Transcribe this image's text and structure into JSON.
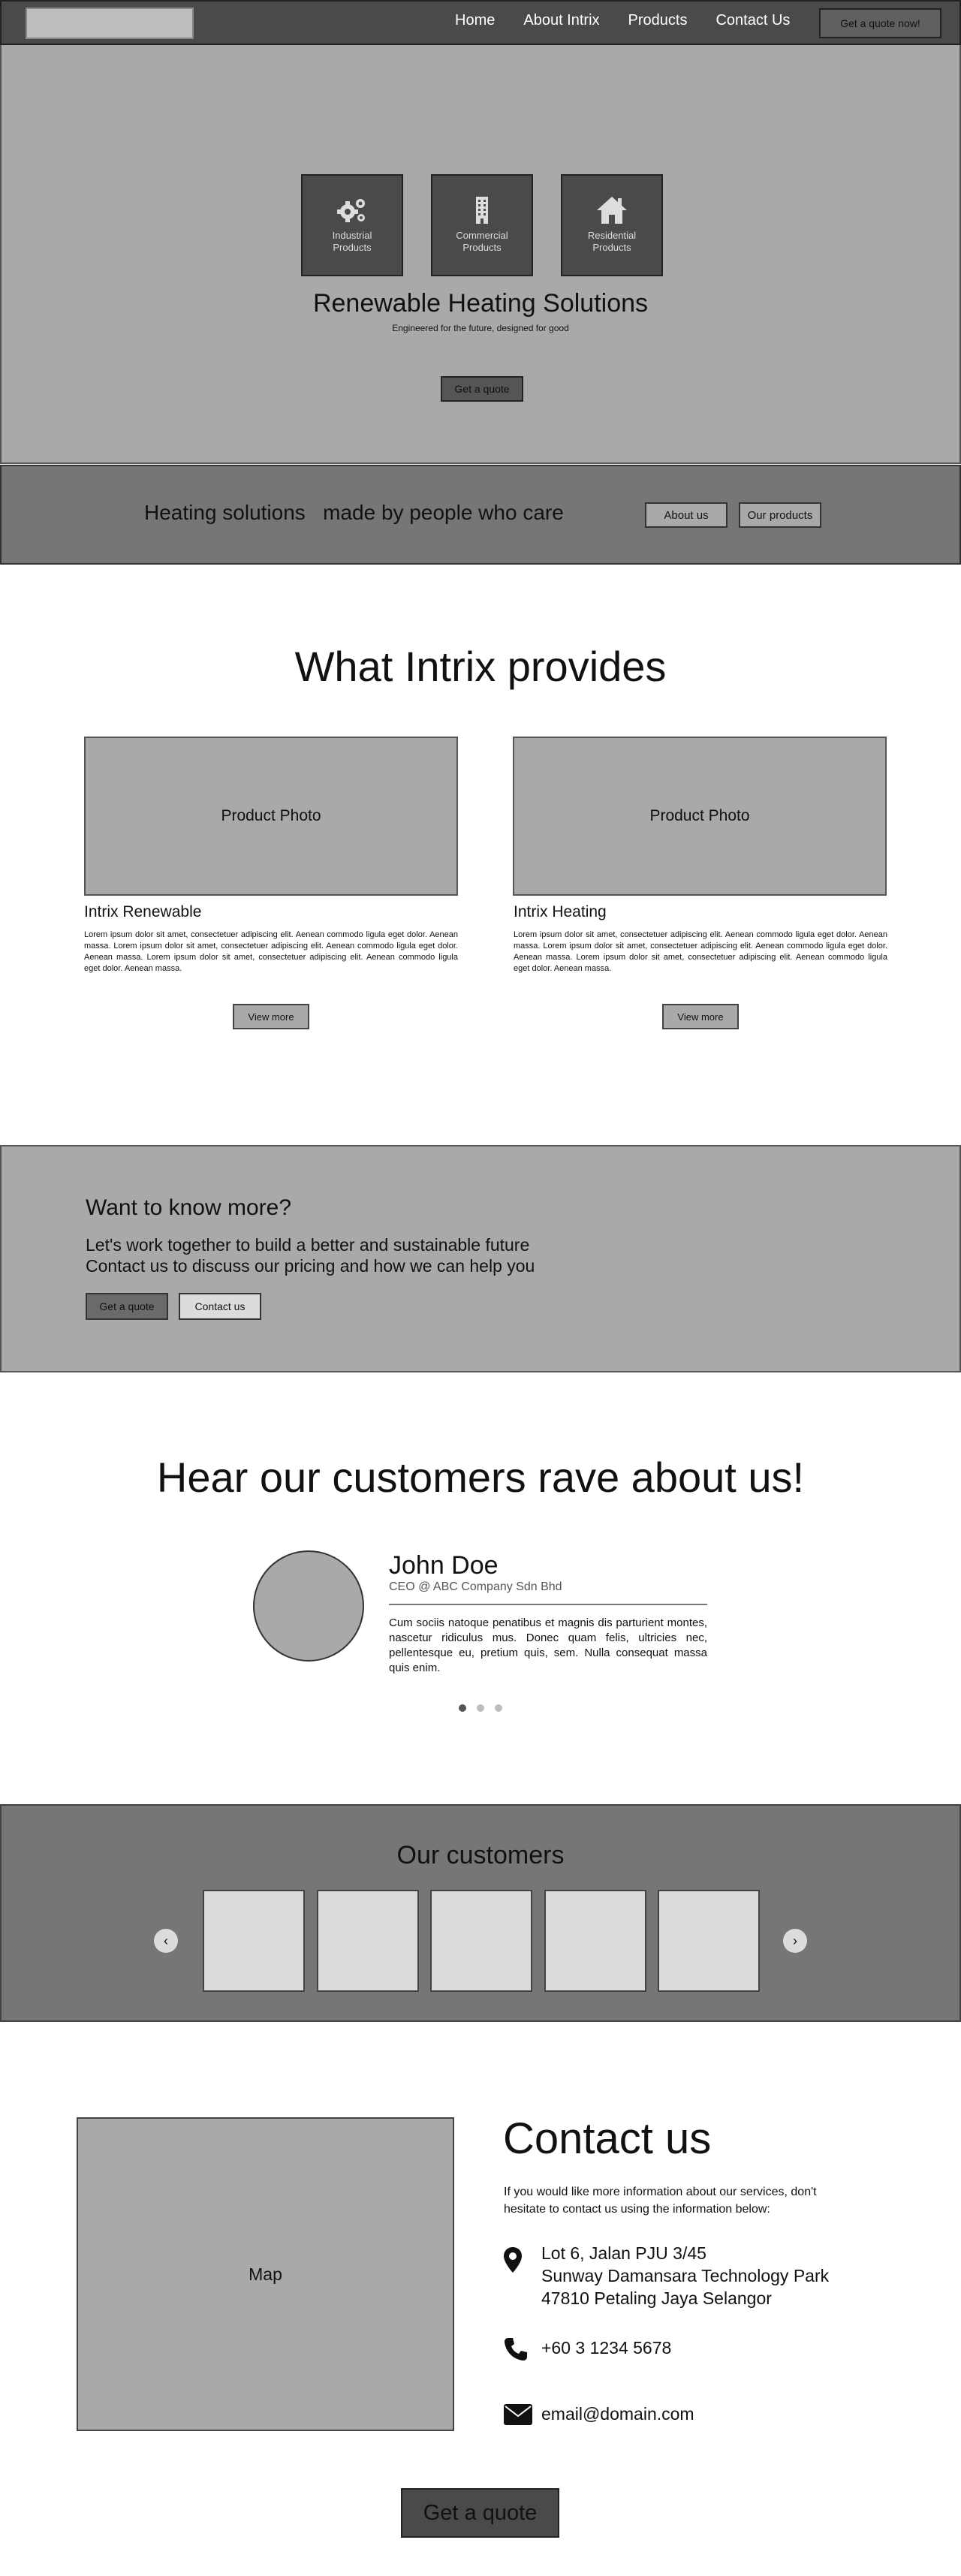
{
  "nav": {
    "links": [
      "Home",
      "About Intrix",
      "Products",
      "Contact Us"
    ],
    "cta": "Get a quote now!"
  },
  "hero": {
    "categories": [
      {
        "icon": "gears-icon",
        "label": "Industrial Products"
      },
      {
        "icon": "building-icon",
        "label": "Commercial Products"
      },
      {
        "icon": "house-icon",
        "label": "Residential Products"
      }
    ],
    "title": "Renewable Heating Solutions",
    "subtitle": "Engineered for the future, designed for good",
    "button": "Get a quote"
  },
  "strip": {
    "text": "Heating solutions   made by people who care",
    "about_button": "About us",
    "products_button": "Our products"
  },
  "provides": {
    "title": "What Intrix provides",
    "products": [
      {
        "photo_label": "Product Photo",
        "name": "Intrix Renewable",
        "description": "Lorem ipsum dolor sit amet, consectetuer adipiscing elit. Aenean commodo ligula eget dolor. Aenean massa. Lorem ipsum dolor sit amet, consectetuer adipiscing elit. Aenean commodo ligula eget dolor. Aenean massa. Lorem ipsum dolor sit amet, consectetuer adipiscing elit. Aenean commodo ligula eget dolor. Aenean massa.",
        "button": "View more"
      },
      {
        "photo_label": "Product Photo",
        "name": "Intrix Heating",
        "description": "Lorem ipsum dolor sit amet, consectetuer adipiscing elit. Aenean commodo ligula eget dolor. Aenean massa. Lorem ipsum dolor sit amet, consectetuer adipiscing elit. Aenean commodo ligula eget dolor. Aenean massa. Lorem ipsum dolor sit amet, consectetuer adipiscing elit. Aenean commodo ligula eget dolor. Aenean massa.",
        "button": "View more"
      }
    ]
  },
  "know_more": {
    "title": "Want to know more?",
    "line1": "Let's work together to build a better and sustainable future",
    "line2": "Contact us to discuss our pricing and how we can help you",
    "quote_button": "Get a quote",
    "contact_button": "Contact us"
  },
  "testimonials": {
    "title": "Hear our customers rave about us!",
    "name": "John Doe",
    "role": "CEO @ ABC Company Sdn Bhd",
    "quote": "Cum sociis natoque penatibus et magnis dis parturient montes, nascetur ridiculus mus. Donec quam felis, ultricies nec, pellentesque eu, pretium quis, sem. Nulla consequat massa quis enim.",
    "active_slide": 1,
    "slide_count": 3
  },
  "customers": {
    "title": "Our customers",
    "prev_icon": "chevron-left-icon",
    "next_icon": "chevron-right-icon",
    "prev_glyph": "‹",
    "next_glyph": "›"
  },
  "contact": {
    "map_label": "Map",
    "title": "Contact us",
    "intro": "If you would like more information about our services,  don't hesitate to contact us using the information below:",
    "address_lines": [
      "Lot 6, Jalan PJU 3/45",
      "Sunway Damansara Technology Park",
      "47810 Petaling Jaya Selangor"
    ],
    "phone": "+60 3 1234 5678",
    "email": "email@domain.com",
    "cta": "Get a quote"
  },
  "colors": {
    "nav_bg": "#4a4a4a",
    "hero_bg": "#a9a9a9",
    "strip_bg": "#767676",
    "placeholder": "#dcdcdc"
  }
}
